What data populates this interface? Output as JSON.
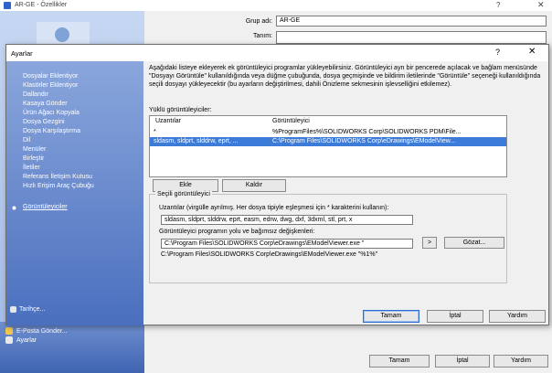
{
  "bg_window": {
    "title": "AR-GE - Özellikler",
    "help": "?",
    "close": "✕",
    "group_label": "Grup adı:",
    "group_value": "AR-GE",
    "desc_label": "Tanım:",
    "desc_value": "",
    "left_bottom": [
      "E-Posta Gönder...",
      "Ayarlar"
    ],
    "buttons": {
      "ok": "Tamam",
      "cancel": "İptal",
      "help": "Yardım"
    }
  },
  "dialog": {
    "title": "Ayarlar",
    "help": "?",
    "close": "✕",
    "nav": [
      "Dosyalar Eklentiyor",
      "Klasörler Eklentiyor",
      "Dallandır",
      "Kasaya Gönder",
      "Ürün Ağacı Kopyala",
      "Dosya Gezgini",
      "Dosya Karşılaştırma",
      "Dil",
      "Menüler",
      "Birleştir",
      "İletiler",
      "Referans İletişim Kutusu",
      "Hızlı Erişim Araç Çubuğu",
      "Görüntüleyiciler"
    ],
    "history": "Tarihçe...",
    "intro": "Aşağıdaki listeye ekleyerek ek görüntüleyici programlar yükleyebilirsiniz. Görüntüleyici ayrı bir pencerede açılacak ve bağlam menüsünde \"Dosyayı Görüntüle\" kullanıldığında veya düğme çubuğunda, dosya geçmişinde ve bildirim iletilerinde \"Görüntüle\" seçeneği kullanıldığında seçili dosyayı yükleyecektir (bu ayarların değiştirilmesi, dahili Önizleme sekmesinin işlevselliğini etkilemez).",
    "installed_label": "Yüklü görüntüleyiciler:",
    "list_headers": {
      "ext": "Uzantılar",
      "viewer": "Görüntüleyici"
    },
    "list_rows": [
      {
        "ext": "*",
        "viewer": "%ProgramFiles%\\SOLIDWORKS Corp\\SOLIDWORKS PDM\\File..."
      },
      {
        "ext": "sldasm, sldprt, slddrw, eprt, ...",
        "viewer": "C:\\Program Files\\SOLIDWORKS Corp\\eDrawings\\EModelView..."
      }
    ],
    "add_button": "Ekle",
    "remove_button": "Kaldır",
    "selected_title": "Seçili görüntüleyici",
    "ext_label": "Uzantılar (virgülle ayrılmış. Her dosya tipiyle eşleşmesi için * karakterini kullanın):",
    "ext_value": "sldasm, sldprt, slddrw, eprt, easm, edrw, dwg, dxf, 3dxml, stl, prt, x",
    "path_label": "Görüntüleyici programın yolu ve bağımsız değişkenleri:",
    "path_value": "C:\\Program Files\\SOLIDWORKS Corp\\eDrawings\\EModelViewer.exe \"",
    "arrow_button": ">",
    "browse_button": "Gözat...",
    "path_preview": "C:\\Program Files\\SOLIDWORKS Corp\\eDrawings\\EModelViewer.exe  \"%1%\"",
    "ok_button": "Tamam",
    "cancel_button": "İptal",
    "help_button": "Yardım"
  },
  "colors": {
    "selection": "#3d7bd9",
    "nav_gradient_top": "#8aa6dc",
    "nav_gradient_bottom": "#4a6fbe"
  }
}
